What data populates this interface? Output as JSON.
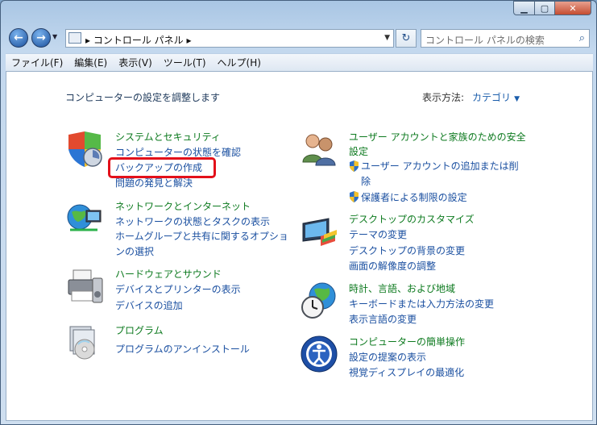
{
  "nav": {
    "address_path": "▸ コントロール パネル ▸",
    "search_placeholder": "コントロール パネルの検索"
  },
  "menu": [
    "ファイル(F)",
    "編集(E)",
    "表示(V)",
    "ツール(T)",
    "ヘルプ(H)"
  ],
  "main": {
    "heading": "コンピューターの設定を調整します",
    "view_by_label": "表示方法:",
    "view_by_value": "カテゴリ"
  },
  "categories": [
    {
      "title": "システムとセキュリティ",
      "icon": "shield-icon",
      "links": [
        "コンピューターの状態を確認",
        "バックアップの作成",
        "問題の発見と解決"
      ]
    },
    {
      "title": "ネットワークとインターネット",
      "icon": "network-globe-icon",
      "links": [
        "ネットワークの状態とタスクの表示",
        "ホームグループと共有に関するオプションの選択"
      ]
    },
    {
      "title": "ハードウェアとサウンド",
      "icon": "printer-icon",
      "links": [
        "デバイスとプリンターの表示",
        "デバイスの追加"
      ]
    },
    {
      "title": "プログラム",
      "icon": "programs-icon",
      "links": [
        "プログラムのアンインストール"
      ]
    },
    {
      "title": "ユーザー アカウントと家族のための安全設定",
      "icon": "users-icon",
      "links": [
        "ユーザー アカウントの追加または削除",
        "保護者による制限の設定"
      ]
    },
    {
      "title": "デスクトップのカスタマイズ",
      "icon": "desktop-icon",
      "links": [
        "テーマの変更",
        "デスクトップの背景の変更",
        "画面の解像度の調整"
      ]
    },
    {
      "title": "時計、言語、および地域",
      "icon": "clock-globe-icon",
      "links": [
        "キーボードまたは入力方法の変更",
        "表示言語の変更"
      ]
    },
    {
      "title": "コンピューターの簡単操作",
      "icon": "ease-of-access-icon",
      "links": [
        "設定の提案の表示",
        "視覚ディスプレイの最適化"
      ]
    }
  ],
  "colors": {
    "category_title": "#0d7a1f",
    "link": "#1a4fa0",
    "highlight": "#e3101a"
  }
}
